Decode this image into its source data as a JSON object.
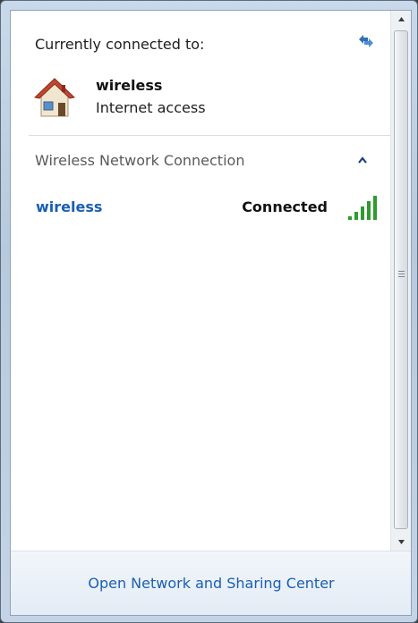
{
  "header": {
    "connected_title": "Currently connected to:",
    "refresh_icon": "refresh-arrows-icon"
  },
  "current_network": {
    "name": "wireless",
    "access": "Internet access",
    "icon": "house-icon"
  },
  "section": {
    "title": "Wireless Network Connection",
    "collapse_icon": "chevron-up-icon"
  },
  "networks": [
    {
      "name": "wireless",
      "status": "Connected",
      "signal_icon": "signal-strength-icon",
      "signal_bars": 5
    }
  ],
  "footer": {
    "link_label": "Open Network and Sharing Center"
  },
  "colors": {
    "link": "#1a5fb4",
    "signal": "#2e9b2e"
  }
}
